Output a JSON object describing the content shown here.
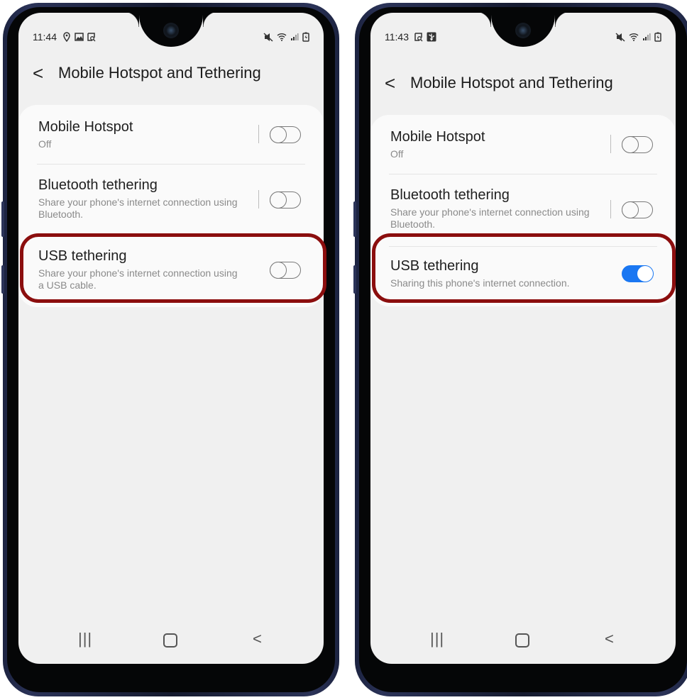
{
  "left_phone": {
    "status": {
      "time": "11:44",
      "icons_left": [
        "location-icon",
        "image-icon",
        "screenshot-icon"
      ],
      "icons_right": [
        "mute-icon",
        "wifi-icon",
        "signal-icon",
        "battery-icon"
      ]
    },
    "header": {
      "back": "<",
      "title": "Mobile Hotspot and Tethering"
    },
    "items": [
      {
        "label": "Mobile Hotspot",
        "sub": "Off",
        "toggle": false
      },
      {
        "label": "Bluetooth tethering",
        "sub": "Share your phone's internet connection using Bluetooth.",
        "toggle": false
      },
      {
        "label": "USB tethering",
        "sub": "Share your phone's internet connection using a USB cable.",
        "toggle": false
      }
    ]
  },
  "right_phone": {
    "status": {
      "time": "11:43",
      "icons_left": [
        "screenshot-icon",
        "usb-icon"
      ],
      "icons_right": [
        "mute-icon",
        "wifi-icon",
        "signal-icon",
        "battery-icon"
      ]
    },
    "header": {
      "back": "<",
      "title": "Mobile Hotspot and Tethering"
    },
    "items": [
      {
        "label": "Mobile Hotspot",
        "sub": "Off",
        "toggle": false
      },
      {
        "label": "Bluetooth tethering",
        "sub": "Share your phone's internet connection using Bluetooth.",
        "toggle": false
      },
      {
        "label": "USB tethering",
        "sub": "Sharing this phone's internet connection.",
        "toggle": true
      }
    ]
  },
  "navbar": {
    "recent": "|||",
    "back": "<"
  },
  "colors": {
    "highlight": "#8b0e0e",
    "toggle_on": "#1a77f2",
    "screen_bg": "#f0f0f0",
    "card_bg": "#fafafa"
  }
}
